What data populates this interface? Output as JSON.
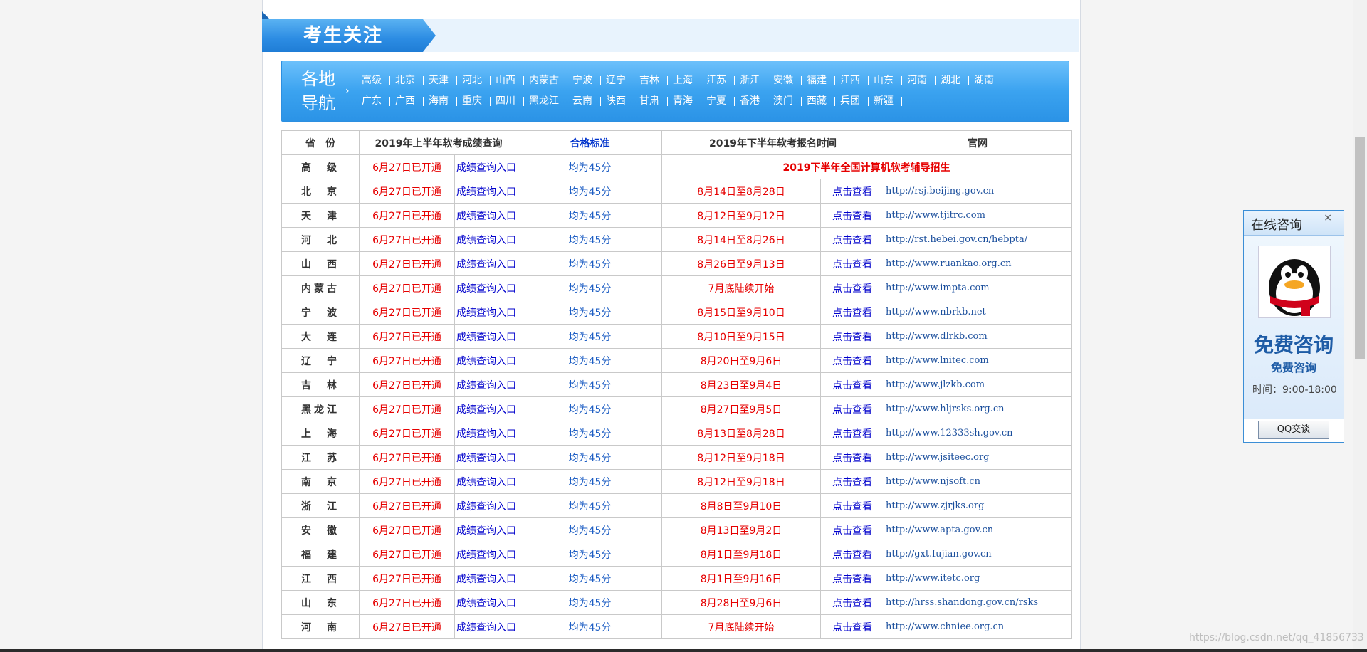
{
  "section_title": "考生关注",
  "region_nav": {
    "label_line1": "各地",
    "label_line2": "导航",
    "row1": [
      "高级",
      "北京",
      "天津",
      "河北",
      "山西",
      "内蒙古",
      "宁波",
      "辽宁",
      "吉林",
      "上海",
      "江苏",
      "浙江",
      "安徽",
      "福建",
      "江西",
      "山东",
      "河南",
      "湖北",
      "湖南"
    ],
    "row2": [
      "广东",
      "广西",
      "海南",
      "重庆",
      "四川",
      "黑龙江",
      "云南",
      "陕西",
      "甘肃",
      "青海",
      "宁夏",
      "香港",
      "澳门",
      "西藏",
      "兵团",
      "新疆"
    ]
  },
  "table": {
    "headers": {
      "province": "省　份",
      "score_query": "2019年上半年软考成绩查询",
      "standard": "合格标准",
      "registration": "2019年下半年软考报名时间",
      "website": "官网"
    },
    "promo_text": "2019下半年全国计算机软考辅导招生",
    "open_text": "6月27日已开通",
    "query_link": "成绩查询入口",
    "standard_text": "均为45分",
    "view_text": "点击查看",
    "rows": [
      {
        "province": "高　级"
      },
      {
        "province": "北　京",
        "date": "8月14日至8月28日",
        "url": "http://rsj.beijing.gov.cn"
      },
      {
        "province": "天　津",
        "date": "8月12日至9月12日",
        "url": "http://www.tjitrc.com"
      },
      {
        "province": "河　北",
        "date": "8月14日至8月26日",
        "url": "http://rst.hebei.gov.cn/hebpta/"
      },
      {
        "province": "山　西",
        "date": "8月26日至9月13日",
        "url": "http://www.ruankao.org.cn"
      },
      {
        "province": "内蒙古",
        "date": "7月底陆续开始",
        "url": "http://www.impta.com"
      },
      {
        "province": "宁　波",
        "date": "8月15日至9月10日",
        "url": "http://www.nbrkb.net"
      },
      {
        "province": "大　连",
        "date": "8月10日至9月15日",
        "url": "http://www.dlrkb.com"
      },
      {
        "province": "辽　宁",
        "date": "8月20日至9月6日",
        "url": "http://www.lnitec.com"
      },
      {
        "province": "吉　林",
        "date": "8月23日至9月4日",
        "url": "http://www.jlzkb.com"
      },
      {
        "province": "黑龙江",
        "date": "8月27日至9月5日",
        "url": "http://www.hljrsks.org.cn"
      },
      {
        "province": "上　海",
        "date": "8月13日至8月28日",
        "url": "http://www.12333sh.gov.cn"
      },
      {
        "province": "江　苏",
        "date": "8月12日至9月18日",
        "url": "http://www.jsiteec.org"
      },
      {
        "province": "南　京",
        "date": "8月12日至9月18日",
        "url": "http://www.njsoft.cn"
      },
      {
        "province": "浙　江",
        "date": "8月8日至9月10日",
        "url": "http://www.zjrjks.org"
      },
      {
        "province": "安　徽",
        "date": "8月13日至9月2日",
        "url": "http://www.apta.gov.cn"
      },
      {
        "province": "福　建",
        "date": "8月1日至9月18日",
        "url": "http://gxt.fujian.gov.cn"
      },
      {
        "province": "江　西",
        "date": "8月1日至9月16日",
        "url": "http://www.itetc.org"
      },
      {
        "province": "山　东",
        "date": "8月28日至9月6日",
        "url": "http://hrss.shandong.gov.cn/rsks"
      },
      {
        "province": "河　南",
        "date": "7月底陆续开始",
        "url": "http://www.chniee.org.cn"
      }
    ]
  },
  "consult": {
    "title": "在线咨询",
    "close": "×",
    "big_text": "免费咨询",
    "sub_text": "免费咨询",
    "time": "时间：9:00-18:00",
    "button": "QQ交谈"
  },
  "watermark": "https://blog.csdn.net/qq_41856733",
  "icons": {
    "close": "close-icon",
    "avatar": "qq-penguin-icon",
    "nav_arrow": "chevron-right-icon"
  },
  "colors": {
    "accent_blue": "#2c8ce3",
    "open_red": "#e60000",
    "link_blue": "#0000cc"
  }
}
